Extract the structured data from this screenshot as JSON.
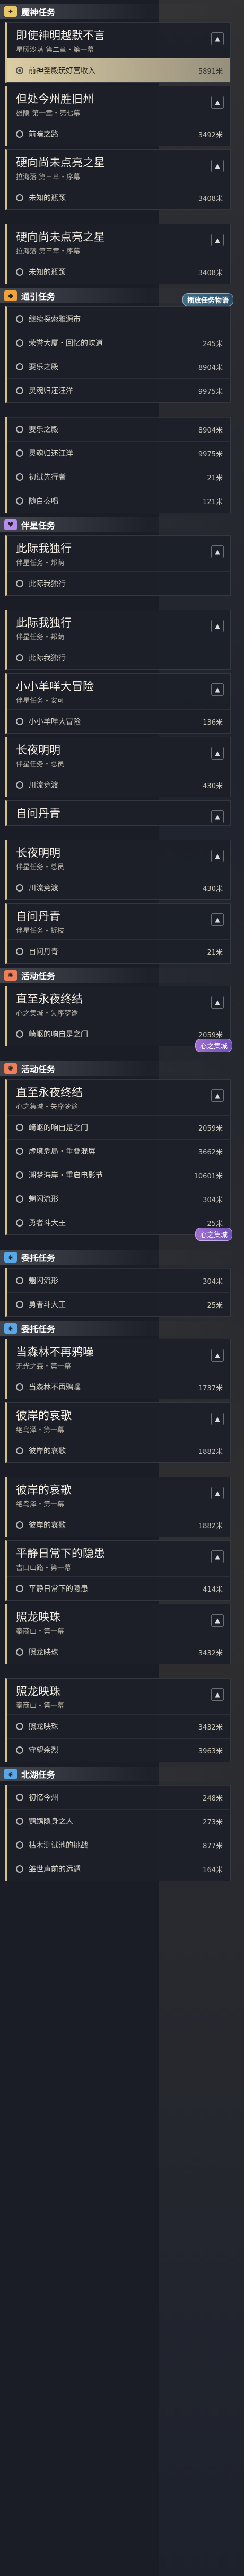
{
  "colors": {
    "archon": "#e9c86a",
    "world": "#f2a23a",
    "companion": "#b68cf0",
    "event": "#ef7f5a",
    "daily": "#58a7e8",
    "background": "#1a1d26"
  },
  "entries": [
    {
      "kind": "group",
      "icon": "star-icon",
      "label": "魔神任务",
      "color": "#e9c86a"
    },
    {
      "kind": "card",
      "title": "即使神明越默不言",
      "sub": "星照沙塔 第二章・第一幕",
      "steps": [
        {
          "text": "前神圣殿玩好营收入",
          "dist": "5891米",
          "hl": true
        }
      ]
    },
    {
      "kind": "card",
      "title": "但处今州胜旧州",
      "sub": "雄隐 第一章・第七幕",
      "steps": [
        {
          "text": "前暗之路",
          "dist": "3492米"
        }
      ]
    },
    {
      "kind": "card",
      "title": "硬向尚未点亮之星",
      "sub": "拉海落 第三章・序幕",
      "steps": [
        {
          "text": "未知的瓶颈",
          "dist": "3408米"
        }
      ]
    },
    {
      "kind": "gap"
    },
    {
      "kind": "card",
      "title": "硬向尚未点亮之星",
      "sub": "拉海落 第三章・序幕",
      "steps": [
        {
          "text": "未知的瓶颈",
          "dist": "3408米"
        }
      ]
    },
    {
      "kind": "group",
      "icon": "compass-icon",
      "label": "通引任务",
      "color": "#f2a23a",
      "tag": "播放任务物语"
    },
    {
      "kind": "steps",
      "steps": [
        {
          "text": "继续探索雅源市",
          "dist": ""
        },
        {
          "text": "荣誉大厦・回忆的峡道",
          "dist": "245米"
        },
        {
          "text": "要乐之殿",
          "dist": "8904米"
        },
        {
          "text": "灵魂归还汪洋",
          "dist": "9975米"
        }
      ]
    },
    {
      "kind": "gap"
    },
    {
      "kind": "steps",
      "steps": [
        {
          "text": "要乐之殿",
          "dist": "8904米"
        },
        {
          "text": "灵魂归还汪洋",
          "dist": "9975米"
        },
        {
          "text": "初试先行者",
          "dist": "21米"
        },
        {
          "text": "随自奏唱",
          "dist": "121米"
        }
      ]
    },
    {
      "kind": "group",
      "icon": "companion-icon",
      "label": "伴星任务",
      "color": "#b68cf0"
    },
    {
      "kind": "card",
      "title": "此际我独行",
      "sub": "伴星任务・邦荫",
      "steps": [
        {
          "text": "此际我独行",
          "dist": ""
        }
      ]
    },
    {
      "kind": "gap"
    },
    {
      "kind": "card",
      "title": "此际我独行",
      "sub": "伴星任务・邦荫",
      "steps": [
        {
          "text": "此际我独行",
          "dist": ""
        }
      ]
    },
    {
      "kind": "card",
      "title": "小小羊咩大冒险",
      "sub": "伴星任务・安可",
      "steps": [
        {
          "text": "小小羊咩大冒险",
          "dist": "136米"
        }
      ]
    },
    {
      "kind": "card",
      "title": "长夜明明",
      "sub": "伴星任务・总员",
      "steps": [
        {
          "text": "川流竞渡",
          "dist": "430米"
        }
      ]
    },
    {
      "kind": "card",
      "title": "自问丹青",
      "sub": "",
      "steps": []
    },
    {
      "kind": "gap"
    },
    {
      "kind": "card",
      "title": "长夜明明",
      "sub": "伴星任务・总员",
      "steps": [
        {
          "text": "川流竞渡",
          "dist": "430米"
        }
      ]
    },
    {
      "kind": "card",
      "title": "自问丹青",
      "sub": "伴星任务・折枝",
      "steps": [
        {
          "text": "自问丹青",
          "dist": "21米"
        }
      ]
    },
    {
      "kind": "group",
      "icon": "event-icon",
      "label": "活动任务",
      "color": "#ef7f5a"
    },
    {
      "kind": "card",
      "title": "直至永夜终结",
      "sub": "心之集城・失序梦途",
      "tag": "心之集城",
      "steps": [
        {
          "text": "崎岖的响自是之门",
          "dist": "2059米"
        }
      ]
    },
    {
      "kind": "gap"
    },
    {
      "kind": "group",
      "icon": "event-icon",
      "label": "活动任务",
      "color": "#ef7f5a"
    },
    {
      "kind": "card",
      "title": "直至永夜终结",
      "sub": "心之集城・失序梦途",
      "tag": "心之集城",
      "steps": [
        {
          "text": "崎岖的响自是之门",
          "dist": "2059米"
        },
        {
          "text": "虚境危局・重叠混屏",
          "dist": "3662米"
        },
        {
          "text": "潮梦海岸・重启电影节",
          "dist": "10601米"
        },
        {
          "text": "魍闪流形",
          "dist": "304米"
        },
        {
          "text": "勇者斗大王",
          "dist": "25米"
        }
      ]
    },
    {
      "kind": "gap"
    },
    {
      "kind": "group",
      "icon": "daily-icon",
      "label": "委托任务",
      "color": "#58a7e8"
    },
    {
      "kind": "steps",
      "steps": [
        {
          "text": "魍闪流形",
          "dist": "304米"
        },
        {
          "text": "勇者斗大王",
          "dist": "25米"
        }
      ]
    },
    {
      "kind": "group",
      "icon": "daily-icon",
      "label": "委托任务",
      "color": "#58a7e8"
    },
    {
      "kind": "card",
      "title": "当森林不再鸦噪",
      "sub": "无光之森・第一幕",
      "steps": [
        {
          "text": "当森林不再鸦噪",
          "dist": "1737米"
        }
      ]
    },
    {
      "kind": "card",
      "title": "彼岸的哀歌",
      "sub": "绝鸟泽・第一幕",
      "steps": [
        {
          "text": "彼岸的哀歌",
          "dist": "1882米"
        }
      ]
    },
    {
      "kind": "gap"
    },
    {
      "kind": "card",
      "title": "彼岸的哀歌",
      "sub": "绝鸟泽・第一幕",
      "steps": [
        {
          "text": "彼岸的哀歌",
          "dist": "1882米"
        }
      ]
    },
    {
      "kind": "card",
      "title": "平静日常下的隐患",
      "sub": "吉口山路・第一幕",
      "steps": [
        {
          "text": "平静日常下的隐患",
          "dist": "414米"
        }
      ]
    },
    {
      "kind": "card",
      "title": "照龙映珠",
      "sub": "秦商山・第一幕",
      "steps": [
        {
          "text": "照龙映珠",
          "dist": "3432米"
        }
      ]
    },
    {
      "kind": "gap"
    },
    {
      "kind": "card",
      "title": "照龙映珠",
      "sub": "秦商山・第一幕",
      "steps": [
        {
          "text": "照龙映珠",
          "dist": "3432米"
        },
        {
          "text": "守望余烈",
          "dist": "3963米"
        }
      ]
    },
    {
      "kind": "group",
      "icon": "daily-icon",
      "label": "北湖任务",
      "color": "#58a7e8"
    },
    {
      "kind": "steps",
      "steps": [
        {
          "text": "初忆今州",
          "dist": "248米"
        },
        {
          "text": "鹦鹉隐身之人",
          "dist": "273米"
        },
        {
          "text": "枯木测试池的挑战",
          "dist": "877米"
        },
        {
          "text": "雏世声前的远遁",
          "dist": "164米"
        }
      ]
    }
  ]
}
